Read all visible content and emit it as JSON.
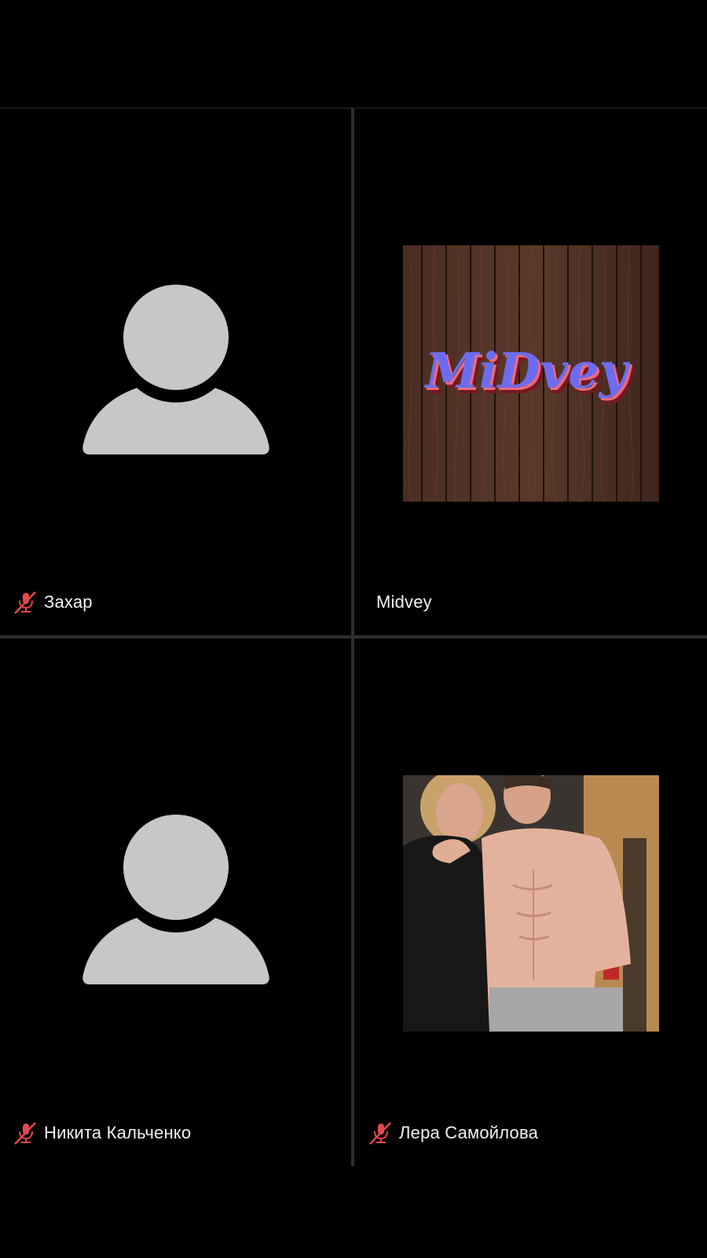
{
  "participants": [
    {
      "name": "Захар",
      "muted": true,
      "avatar": "default-person-icon"
    },
    {
      "name": "Midvey",
      "muted": false,
      "avatar": "midvey-logo-photo"
    },
    {
      "name": "Никита Кальченко",
      "muted": true,
      "avatar": "default-person-icon"
    },
    {
      "name": "Лера Самойлова",
      "muted": true,
      "avatar": "couple-selfie-photo"
    }
  ],
  "logo_text": "MiDvey",
  "colors": {
    "background": "#000000",
    "divider": "#2e2e2e",
    "avatar_placeholder": "#c7c6c8",
    "muted_icon": "#e5484d",
    "label": "#f2f2f2"
  }
}
